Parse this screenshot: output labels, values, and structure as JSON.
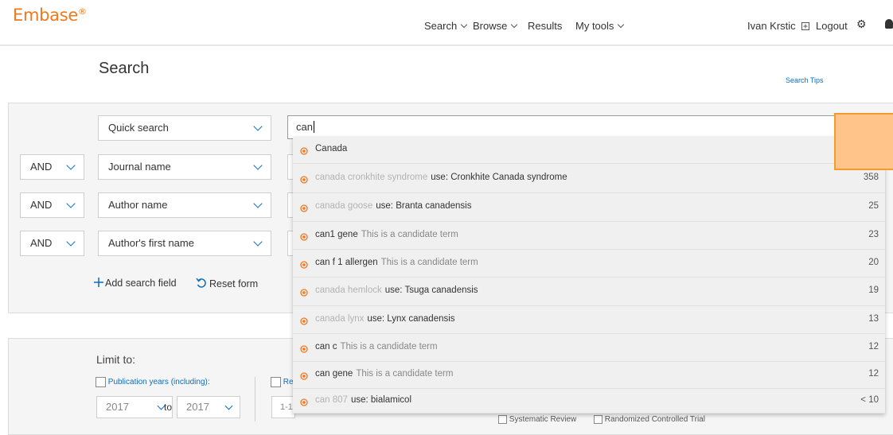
{
  "header": {
    "logo": "Embase",
    "logo_mark": "®",
    "nav": {
      "search": "Search",
      "browse": "Browse",
      "results": "Results",
      "my_tools": "My tools"
    },
    "user": "Ivan Krstic",
    "logout": "Logout"
  },
  "page": {
    "title": "Search",
    "search_tips": "Search Tips"
  },
  "form": {
    "rows": [
      {
        "field": "Quick search"
      },
      {
        "operator": "AND",
        "field": "Journal name"
      },
      {
        "operator": "AND",
        "field": "Author name"
      },
      {
        "operator": "AND",
        "field": "Author's first name"
      }
    ],
    "query": "can",
    "add_field": "Add search field",
    "reset": "Reset form"
  },
  "limits": {
    "title": "Limit to:",
    "pub_years_label": "Publication years (including):",
    "year_from": "2017",
    "year_to": "2017",
    "to_label": "to",
    "partial_re": "Re",
    "partial_range": "1-1",
    "systematic_review": "Systematic Review",
    "rct": "Randomized Controlled Trial"
  },
  "suggestions": [
    {
      "term": "Canada",
      "term_style": "main",
      "suffix": "",
      "suffix_style": "",
      "count": ""
    },
    {
      "term": "canada cronkhite syndrome",
      "term_style": "grey",
      "suffix": "use: Cronkhite Canada syndrome",
      "suffix_style": "main",
      "count": "358"
    },
    {
      "term": "canada goose",
      "term_style": "grey",
      "suffix": "use: Branta canadensis",
      "suffix_style": "main",
      "count": "25"
    },
    {
      "term": "can1 gene",
      "term_style": "main",
      "suffix": "This is a candidate term",
      "suffix_style": "note",
      "count": "23"
    },
    {
      "term": "can f 1 allergen",
      "term_style": "main",
      "suffix": "This is a candidate term",
      "suffix_style": "note",
      "count": "20"
    },
    {
      "term": "canada hemlock",
      "term_style": "grey",
      "suffix": "use: Tsuga canadensis",
      "suffix_style": "main",
      "count": "19"
    },
    {
      "term": "canada lynx",
      "term_style": "grey",
      "suffix": "use: Lynx canadensis",
      "suffix_style": "main",
      "count": "13"
    },
    {
      "term": "can c",
      "term_style": "main",
      "suffix": "This is a candidate term",
      "suffix_style": "note",
      "count": "12"
    },
    {
      "term": "can gene",
      "term_style": "main",
      "suffix": "This is a candidate term",
      "suffix_style": "note",
      "count": "12"
    },
    {
      "term": "can 807",
      "term_style": "grey",
      "suffix": "use: bialamicol",
      "suffix_style": "main",
      "count": "< 10"
    }
  ],
  "colors": {
    "brand": "#f0781e",
    "link": "#0a6ebd",
    "tooltip_fill": "#ffc48a",
    "tooltip_border": "#f29b2f"
  },
  "icons": {
    "user": "external-link-icon",
    "settings": "gear-icon",
    "notify": "bell-icon",
    "suggestion": "target-dot-icon"
  }
}
